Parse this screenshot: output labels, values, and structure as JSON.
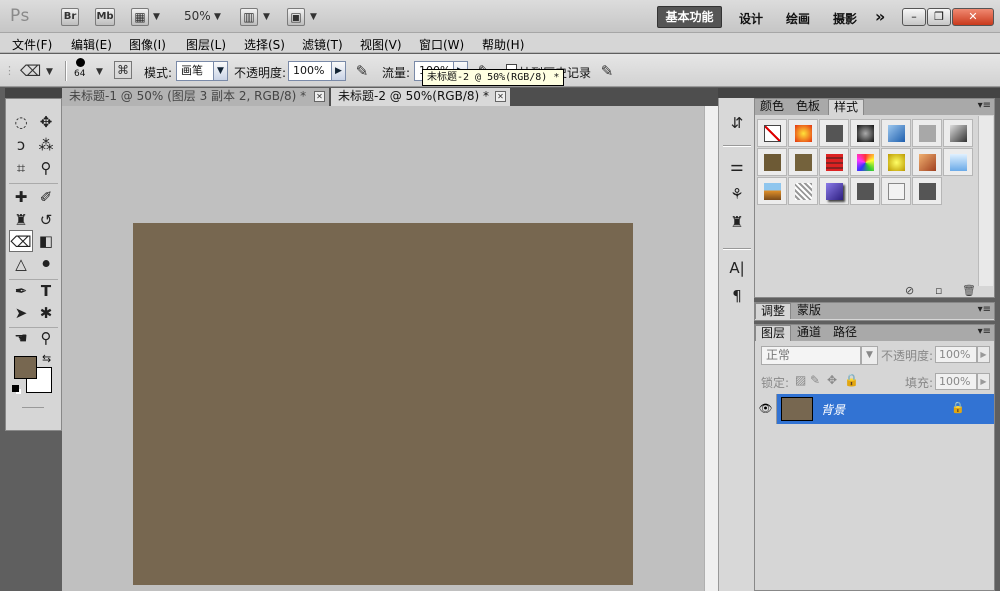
{
  "titlebar": {
    "logo": "Ps",
    "bridge": "Br",
    "minibridge": "Mb",
    "zoom": "50%",
    "workspace_active": "基本功能",
    "workspaces": [
      "设计",
      "绘画",
      "摄影"
    ],
    "more": "»"
  },
  "menu": [
    "文件(F)",
    "编辑(E)",
    "图像(I)",
    "图层(L)",
    "选择(S)",
    "滤镜(T)",
    "视图(V)",
    "窗口(W)",
    "帮助(H)"
  ],
  "options": {
    "brush_size": "64",
    "mode_label": "模式:",
    "mode_value": "画笔",
    "opacity_label": "不透明度:",
    "opacity_value": "100%",
    "flow_label": "流量:",
    "flow_value": "100%",
    "erase_history_label": "抹到历史记录"
  },
  "tooltip": "未标题-2 @ 50%(RGB/8) *",
  "documents": {
    "tabs": [
      {
        "label": "未标题-1 @ 50% (图层 3 副本 2, RGB/8) *",
        "active": false
      },
      {
        "label": "未标题-2 @ 50%(RGB/8) *",
        "active": true
      }
    ],
    "canvas_color": "#776750"
  },
  "colors": {
    "foreground": "#776750",
    "background": "#ffffff"
  },
  "panels": {
    "top_tabs": [
      "颜色",
      "色板",
      "样式"
    ],
    "adjust_tabs": [
      "调整",
      "蒙版"
    ],
    "layer_tabs": [
      "图层",
      "通道",
      "路径"
    ]
  },
  "layers": {
    "blend_mode": "正常",
    "opacity_label": "不透明度:",
    "opacity_value": "100%",
    "lock_label": "锁定:",
    "fill_label": "填充:",
    "fill_value": "100%",
    "items": [
      {
        "name": "背景",
        "visible": true,
        "locked": true,
        "selected": true
      }
    ]
  }
}
